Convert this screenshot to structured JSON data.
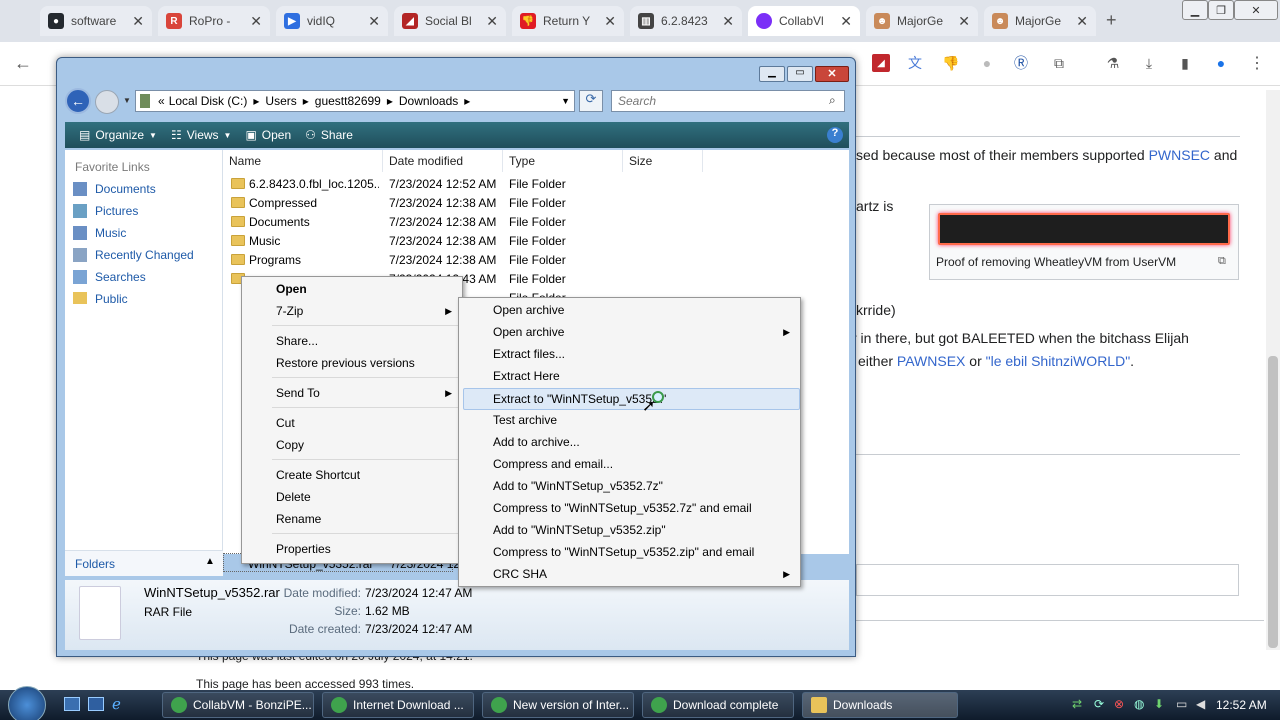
{
  "browser": {
    "tabs": [
      {
        "title": "software",
        "color": "#24292f"
      },
      {
        "title": "RoPro - ",
        "color": "#d9453b"
      },
      {
        "title": "vidIQ",
        "color": "#2f6fe0"
      },
      {
        "title": "Social Bl",
        "color": "#b32525"
      },
      {
        "title": "Return Y",
        "color": "#e01b24"
      },
      {
        "title": "6.2.8423",
        "color": "#444444"
      },
      {
        "title": "CollabVl",
        "color": "#7b2ff7"
      },
      {
        "title": "MajorGe",
        "color": "#c98a5a"
      },
      {
        "title": "MajorGe",
        "color": "#c98a5a"
      }
    ],
    "new_tab": "+"
  },
  "wiki": {
    "line1_pre": "sed because most of their members supported ",
    "line1_link": "PWNSEC",
    "line1_post": " and",
    "line2": "artz is",
    "image_caption": "Proof of removing WheatleyVM from UserVM",
    "line3": "krride)",
    "line4": "r in there, but got BALEETED when the bitchass Elijah",
    "line5_pre": "either ",
    "line5_link1": "PAWNSEX",
    "line5_mid": " or ",
    "line5_link2": "\"le ebil ShitnziWORLD\"",
    "line5_post": ".",
    "footer1": "This page was last edited on 20 July 2024, at 14:21.",
    "footer2": "This page has been accessed 993 times."
  },
  "explorer": {
    "breadcrumb": [
      "Local Disk (C:)",
      "Users",
      "guestt82699",
      "Downloads"
    ],
    "search_placeholder": "Search",
    "toolbar": {
      "organize": "Organize",
      "views": "Views",
      "open": "Open",
      "share": "Share",
      "help": "?"
    },
    "nav_header": "Favorite Links",
    "nav_items": [
      "Documents",
      "Pictures",
      "Music",
      "Recently Changed",
      "Searches",
      "Public"
    ],
    "folders_label": "Folders",
    "columns": [
      "Name",
      "Date modified",
      "Type",
      "Size"
    ],
    "files": [
      {
        "name": "6.2.8423.0.fbl_loc.1205...",
        "date": "7/23/2024 12:52 AM",
        "type": "File Folder"
      },
      {
        "name": "Compressed",
        "date": "7/23/2024 12:38 AM",
        "type": "File Folder"
      },
      {
        "name": "Documents",
        "date": "7/23/2024 12:38 AM",
        "type": "File Folder"
      },
      {
        "name": "Music",
        "date": "7/23/2024 12:38 AM",
        "type": "File Folder"
      },
      {
        "name": "Programs",
        "date": "7/23/2024 12:38 AM",
        "type": "File Folder"
      },
      {
        "name": "",
        "date": "7/23/2024 12:43 AM",
        "type": "File Folder"
      },
      {
        "name": "",
        "date": "",
        "type": "File Folder"
      }
    ],
    "selected_file": {
      "name": "WinNTSetup_v5352.rar",
      "date": "7/23/2024 12"
    },
    "details": {
      "name": "WinNTSetup_v5352.rar",
      "kind": "RAR File",
      "modified_label": "Date modified:",
      "modified": "7/23/2024 12:47 AM",
      "size_label": "Size:",
      "size": "1.62 MB",
      "created_label": "Date created:",
      "created": "7/23/2024 12:47 AM"
    }
  },
  "context_menu": {
    "open": "Open",
    "sevenzip": "7-Zip",
    "share": "Share...",
    "restore": "Restore previous versions",
    "send_to": "Send To",
    "cut": "Cut",
    "copy": "Copy",
    "create_shortcut": "Create Shortcut",
    "delete": "Delete",
    "rename": "Rename",
    "properties": "Properties"
  },
  "sevenzip_menu": {
    "items": [
      "Open archive",
      "Open archive",
      "Extract files...",
      "Extract Here",
      "Extract to \"WinNTSetup_v5352\\\"",
      "Test archive",
      "Add to archive...",
      "Compress and email...",
      "Add to \"WinNTSetup_v5352.7z\"",
      "Compress to \"WinNTSetup_v5352.7z\" and email",
      "Add to \"WinNTSetup_v5352.zip\"",
      "Compress to \"WinNTSetup_v5352.zip\" and email",
      "CRC SHA"
    ]
  },
  "taskbar": {
    "items": [
      {
        "label": "CollabVM - BonziPE..."
      },
      {
        "label": "Internet Download ..."
      },
      {
        "label": "New version of Inter..."
      },
      {
        "label": "Download complete"
      },
      {
        "label": "Downloads"
      }
    ],
    "clock": "12:52 AM"
  }
}
